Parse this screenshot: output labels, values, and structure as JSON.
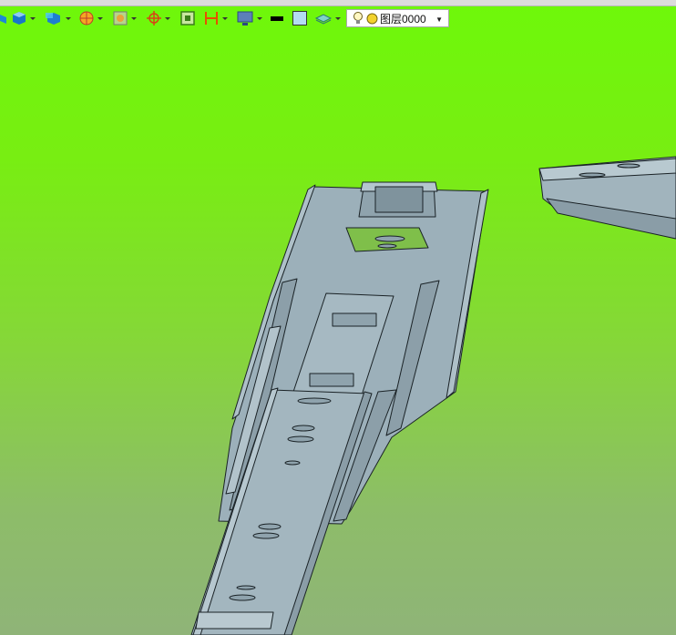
{
  "toolbar": {
    "layer_selector": {
      "value": "图层0000"
    }
  },
  "colors": {
    "background_top": "#6ef80a",
    "background_bottom": "#8fb478",
    "part_fill": "#9fb3bd",
    "part_edge": "#1a2226"
  }
}
